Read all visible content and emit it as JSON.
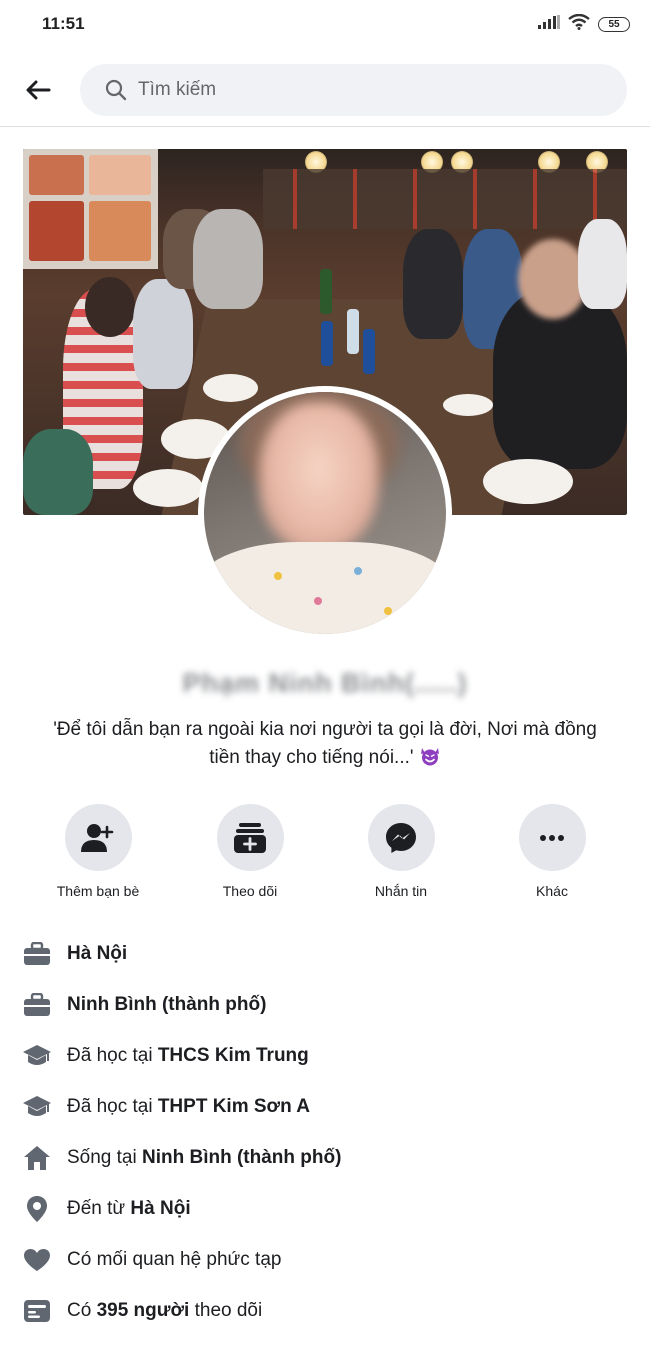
{
  "status_bar": {
    "time": "11:51",
    "battery": "55"
  },
  "header": {
    "search_placeholder": "Tìm kiếm"
  },
  "profile": {
    "name": "Phạm Ninh Bình(.....)",
    "bio": "'Để tôi dẫn bạn ra ngoài kia nơi người ta gọi là đời, Nơi mà đồng tiền thay cho tiếng nói...'"
  },
  "actions": [
    {
      "label": "Thêm bạn bè",
      "icon": "add-friend-icon"
    },
    {
      "label": "Theo dõi",
      "icon": "follow-icon"
    },
    {
      "label": "Nhắn tin",
      "icon": "messenger-icon"
    },
    {
      "label": "Khác",
      "icon": "more-icon"
    }
  ],
  "intro": [
    {
      "icon": "briefcase-icon",
      "prefix": "",
      "bold": "Hà Nội",
      "suffix": ""
    },
    {
      "icon": "briefcase-icon",
      "prefix": "",
      "bold": "Ninh Bình (thành phố)",
      "suffix": ""
    },
    {
      "icon": "graduation-cap-icon",
      "prefix": "Đã học tại ",
      "bold": "THCS Kim Trung",
      "suffix": ""
    },
    {
      "icon": "graduation-cap-icon",
      "prefix": "Đã học tại ",
      "bold": "THPT Kim Sơn A",
      "suffix": ""
    },
    {
      "icon": "home-icon",
      "prefix": "Sống tại ",
      "bold": "Ninh Bình (thành phố)",
      "suffix": ""
    },
    {
      "icon": "location-pin-icon",
      "prefix": "Đến từ ",
      "bold": "Hà Nội",
      "suffix": ""
    },
    {
      "icon": "heart-icon",
      "prefix": "Có mối quan hệ phức tạp",
      "bold": "",
      "suffix": ""
    },
    {
      "icon": "followers-icon",
      "prefix": "Có ",
      "bold": "395 người",
      "suffix": " theo dõi"
    }
  ],
  "colors": {
    "icon_gray": "#606770",
    "button_bg": "#e4e6eb",
    "search_bg": "#f0f2f5",
    "emoji_purple": "#8e3fbf"
  }
}
